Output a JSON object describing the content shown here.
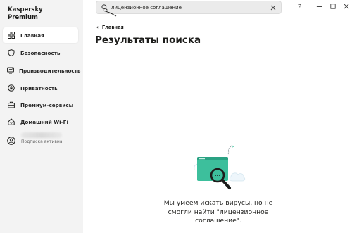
{
  "app": {
    "name_line1": "Kaspersky",
    "name_line2": "Premium"
  },
  "sidebar": {
    "items": [
      {
        "label": "Главная",
        "icon": "home-grid-icon",
        "active": true
      },
      {
        "label": "Безопасность",
        "icon": "shield-icon",
        "active": false
      },
      {
        "label": "Производительность",
        "icon": "monitor-icon",
        "active": false
      },
      {
        "label": "Приватность",
        "icon": "privacy-lock-icon",
        "active": false
      },
      {
        "label": "Премиум-сервисы",
        "icon": "briefcase-icon",
        "active": false
      },
      {
        "label": "Домашний Wi-Fi",
        "icon": "home-wifi-icon",
        "active": false
      }
    ],
    "account": {
      "status": "Подписка активна",
      "icon": "user-avatar-icon"
    }
  },
  "search": {
    "value": "лицензионное соглашение",
    "icon": "search-icon"
  },
  "window": {
    "help": "?"
  },
  "breadcrumb": {
    "label": "Главная"
  },
  "page": {
    "title": "Результаты поиска"
  },
  "empty_state": {
    "line1": "Мы умеем искать вирусы, но не",
    "line2": "смогли найти \"лицензионное",
    "line3": "соглашение\"."
  },
  "colors": {
    "accent": "#3dbf9c",
    "dark": "#1d1d1b",
    "sidebar_bg": "#f3f3f3"
  }
}
